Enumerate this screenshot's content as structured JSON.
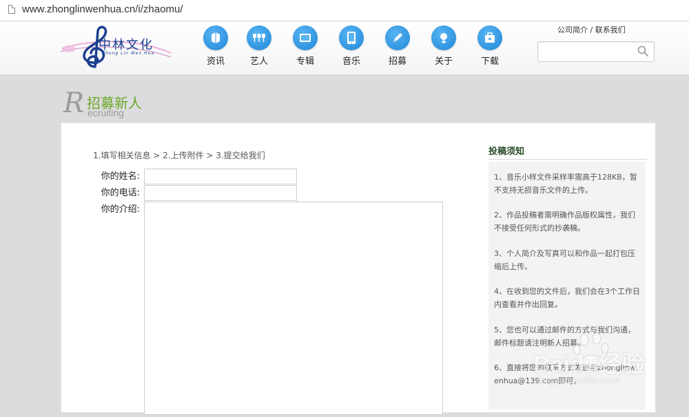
{
  "browser": {
    "url": "www.zhonglinwenhua.cn/i/zhaomu/"
  },
  "logo": {
    "cn_text": "中林文化",
    "en_text": "Zhong Lin Wen Hua"
  },
  "nav": [
    {
      "label": "资讯",
      "icon": "news-icon"
    },
    {
      "label": "艺人",
      "icon": "artists-icon"
    },
    {
      "label": "专辑",
      "icon": "album-icon"
    },
    {
      "label": "音乐",
      "icon": "music-icon"
    },
    {
      "label": "招募",
      "icon": "recruit-pen-icon"
    },
    {
      "label": "关于",
      "icon": "about-icon"
    },
    {
      "label": "下载",
      "icon": "download-icon"
    }
  ],
  "top_links": {
    "about": "公司简介",
    "sep": " / ",
    "contact": "联系我们"
  },
  "search": {
    "placeholder": ""
  },
  "section": {
    "letter": "R",
    "title_cn": "招募新人",
    "title_en": "ecruiting"
  },
  "form": {
    "steps": "1.填写相关信息 > 2.上传附件 > 3.提交给我们",
    "name_label": "你的姓名:",
    "phone_label": "你的电话:",
    "intro_label": "你的介绍:"
  },
  "notice": {
    "title": "投稿须知",
    "items": [
      "1、音乐小样文件采样率需高于128KB，暂不支持无损音乐文件的上传。",
      "2、作品投稿者需明确作品版权属性，我们不接受任何形式的抄袭稿。",
      "3、个人简介及写真可以和作品一起打包压缩后上传。",
      "4、在收到您的文件后，我们会在3个工作日内查看并作出回复。",
      "5、您也可以通过邮件的方式与我们沟通，邮件标题请注明新人招募。",
      "6、直接将您的联系方式发送至zhonglinwenhua@139.com即可。"
    ]
  },
  "watermark": {
    "text": "Baidu经验",
    "sub": "jingyan.baidu.com"
  },
  "colors": {
    "nav_blue": "#2a8de0",
    "title_green": "#6aa827"
  }
}
